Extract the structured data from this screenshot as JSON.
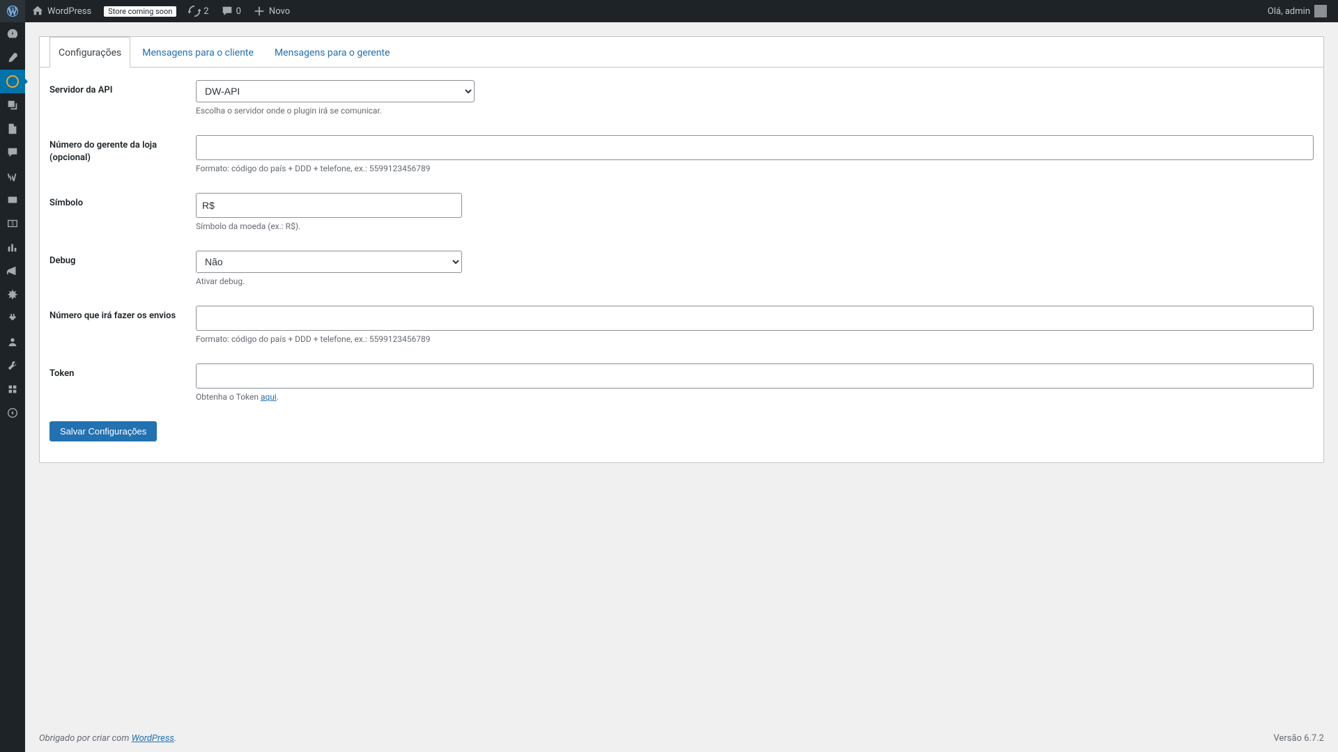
{
  "adminbar": {
    "site_name": "WordPress",
    "store_badge": "Store coming soon",
    "updates_count": "2",
    "comments_count": "0",
    "new_label": "Novo",
    "greeting": "Olá, admin"
  },
  "tabs": {
    "config": "Configurações",
    "client_msgs": "Mensagens para o cliente",
    "manager_msgs": "Mensagens para o gerente"
  },
  "fields": {
    "api_server": {
      "label": "Servidor da API",
      "value": "DW-API",
      "description": "Escolha o servidor onde o plugin irá se comunicar."
    },
    "manager_number": {
      "label": "Número do gerente da loja (opcional)",
      "value": "",
      "description": "Formato: código do país + DDD + telefone, ex.: 5599123456789"
    },
    "symbol": {
      "label": "Símbolo",
      "value": "R$",
      "description": "Símbolo da moeda (ex.: R$)."
    },
    "debug": {
      "label": "Debug",
      "value": "Não",
      "description": "Ativar debug."
    },
    "sender_number": {
      "label": "Número que irá fazer os envios",
      "value": "",
      "description": "Formato: código do país + DDD + telefone, ex.: 5599123456789"
    },
    "token": {
      "label": "Token",
      "value": "",
      "description_pre": "Obtenha o Token ",
      "description_link": "aqui",
      "description_post": "."
    }
  },
  "save_button": "Salvar Configurações",
  "footer": {
    "pre": "Obrigado por criar com ",
    "link": "WordPress",
    "post": ".",
    "version": "Versão 6.7.2"
  }
}
